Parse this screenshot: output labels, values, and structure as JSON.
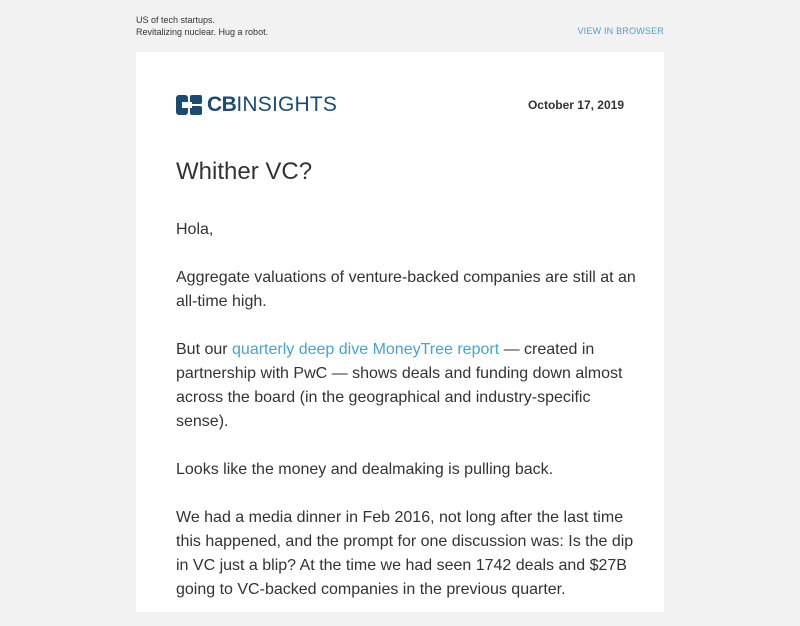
{
  "preheader": {
    "line1": "US of tech startups.",
    "line2": "Revitalizing nuclear. Hug a robot.",
    "view_in_browser": "VIEW IN BROWSER"
  },
  "header": {
    "logo_cb": "CB",
    "logo_insights": "INSIGHTS",
    "date": "October 17, 2019"
  },
  "title": "Whither VC?",
  "body": {
    "greeting": "Hola,",
    "p1": "Aggregate valuations of venture-backed companies are still at an all-time high.",
    "p2_prefix": "But our ",
    "p2_link": "quarterly deep dive MoneyTree report",
    "p2_suffix": " — created in partnership with PwC — shows deals and funding down almost across the board (in the geographical and industry-specific sense).",
    "p3": "Looks like the money and dealmaking is pulling back.",
    "p4": "We had a media dinner in Feb 2016, not long after the last time this happened, and the prompt for one discussion was: Is the dip in VC just a blip? At the time we had seen 1742 deals and $27B going to VC-backed companies in the previous quarter."
  },
  "colors": {
    "background": "#f2f2f2",
    "card": "#ffffff",
    "link": "#4aa3c8",
    "brand": "#1b4a73",
    "text": "#333333"
  }
}
